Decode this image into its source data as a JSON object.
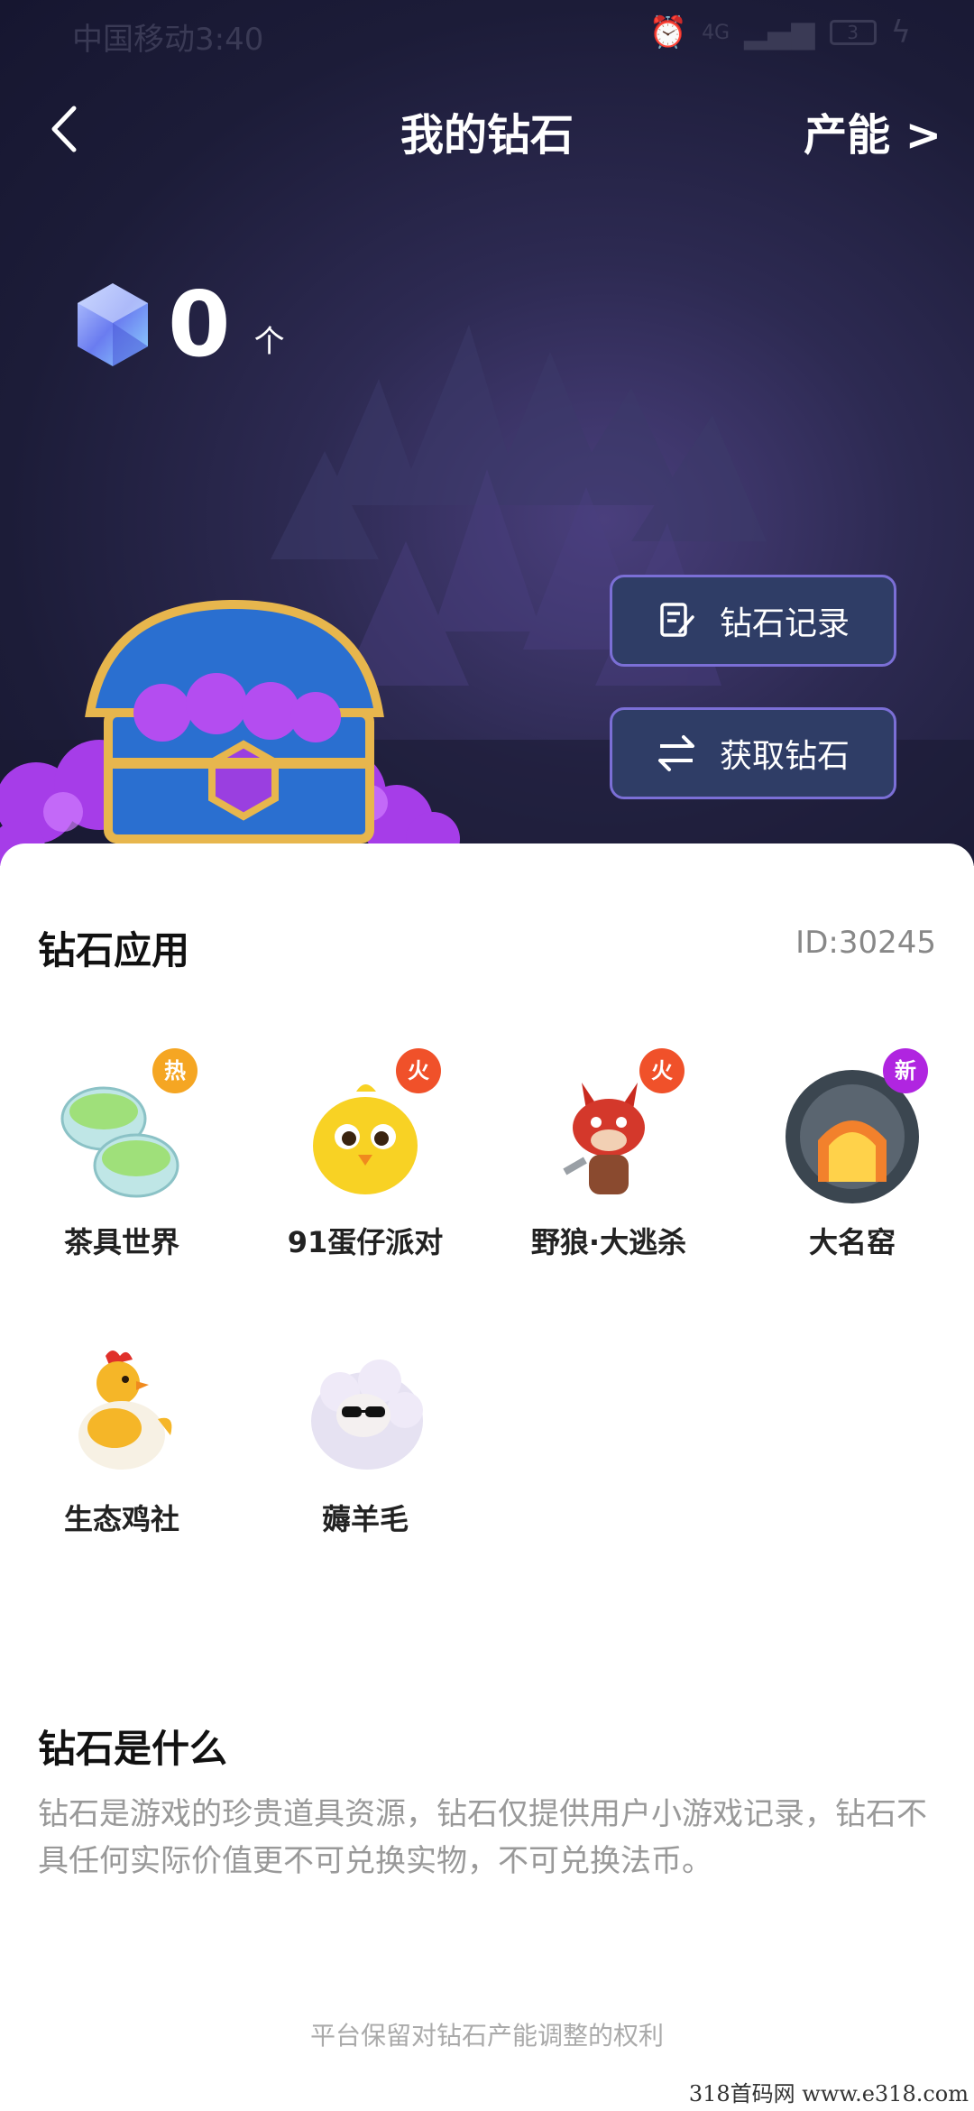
{
  "status_bar": {
    "carrier_time": "中国移动3:40",
    "network": "4G",
    "battery": "3"
  },
  "nav": {
    "title": "我的钻石",
    "right_link": "产能 >"
  },
  "balance": {
    "value": "0",
    "unit": "个"
  },
  "actions": {
    "record_label": "钻石记录",
    "obtain_label": "获取钻石"
  },
  "apps_section": {
    "title": "钻石应用",
    "id_label": "ID:30245",
    "apps": [
      {
        "name": "茶具世界",
        "tag": "热",
        "tag_color": "#f5a623"
      },
      {
        "name": "91蛋仔派对",
        "tag": "火",
        "tag_color": "#f0512a"
      },
      {
        "name": "野狼·大逃杀",
        "tag": "火",
        "tag_color": "#f0512a"
      },
      {
        "name": "大名窑",
        "tag": "新",
        "tag_color": "#b025e0"
      },
      {
        "name": "生态鸡社",
        "tag": "",
        "tag_color": ""
      },
      {
        "name": "薅羊毛",
        "tag": "",
        "tag_color": ""
      }
    ]
  },
  "about": {
    "title": "钻石是什么",
    "text": "钻石是游戏的珍贵道具资源，钻石仅提供用户小游戏记录，钻石不具任何实际价值更不可兑换实物，不可兑换法币。"
  },
  "footer_note": "平台保留对钻石产能调整的权利",
  "watermark": "318首码网   www.e318.com",
  "colors": {
    "hero_bg": "#1c1c38",
    "button_bg": "#2f3d66",
    "button_border": "#7b6fd6"
  }
}
